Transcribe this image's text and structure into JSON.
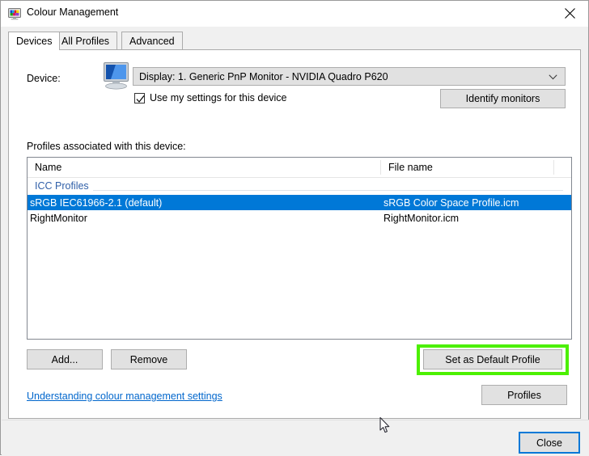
{
  "window": {
    "title": "Colour Management",
    "icon": "colour-management-monitor-icon",
    "close_icon": "close-icon"
  },
  "tabs": [
    {
      "label": "Devices",
      "active": true
    },
    {
      "label": "All Profiles",
      "active": false
    },
    {
      "label": "Advanced",
      "active": false
    }
  ],
  "device_section": {
    "label": "Device:",
    "icon": "monitor-icon",
    "combo_value": "Display: 1. Generic PnP Monitor - NVIDIA Quadro P620",
    "combo_arrow_icon": "chevron-down-icon",
    "checkbox_label": "Use my settings for this device",
    "checkbox_checked": true,
    "identify_button": "Identify monitors"
  },
  "profiles": {
    "caption": "Profiles associated with this device:",
    "columns": [
      "Name",
      "File name"
    ],
    "group_label": "ICC Profiles",
    "rows": [
      {
        "name": "sRGB IEC61966-2.1 (default)",
        "file": "sRGB Color Space Profile.icm",
        "selected": true
      },
      {
        "name": "RightMonitor",
        "file": "RightMonitor.icm",
        "selected": false
      }
    ]
  },
  "buttons": {
    "add": "Add...",
    "remove": "Remove",
    "set_default": "Set as Default Profile",
    "profiles": "Profiles",
    "close": "Close"
  },
  "link": {
    "text": "Understanding colour management settings"
  },
  "colors": {
    "selection": "#0078d7",
    "highlight_annotation": "#4cf000",
    "link": "#0066cc",
    "group_label": "#2f5fa8",
    "focus_border": "#0078d7"
  }
}
